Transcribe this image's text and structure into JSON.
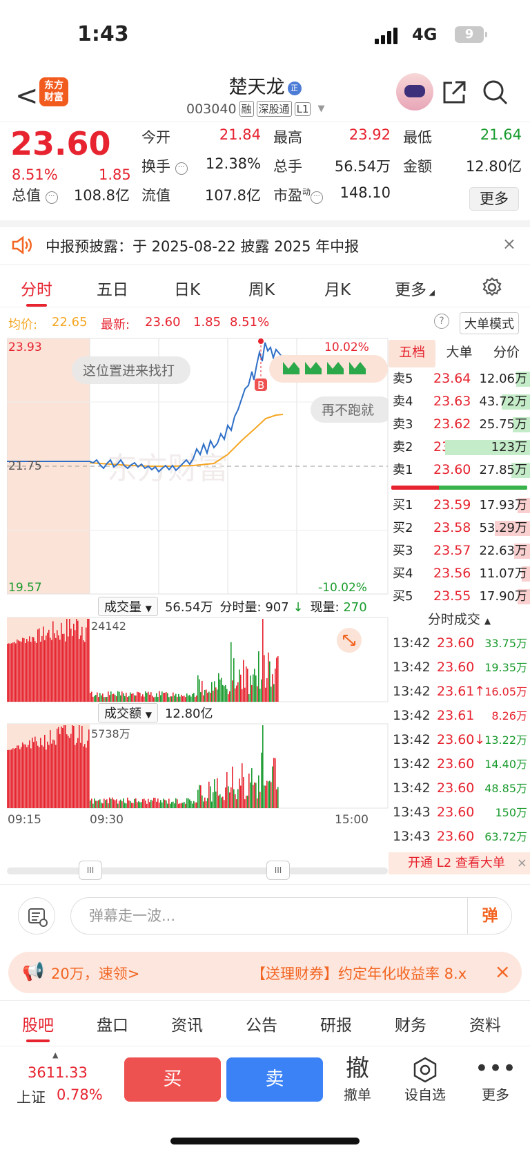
{
  "status": {
    "time": "1:43",
    "network": "4G",
    "battery": "9"
  },
  "header": {
    "back": "<",
    "logo_line1": "东方",
    "logo_line2": "财富",
    "name": "楚天龙",
    "name_badge": "正",
    "code": "003040",
    "tags": [
      "融",
      "深股通",
      "L1"
    ]
  },
  "quote": {
    "price": "23.60",
    "change_pct": "8.51%",
    "change_abs": "1.85",
    "open_label": "今开",
    "open": "21.84",
    "high_label": "最高",
    "high": "23.92",
    "low_label": "最低",
    "low": "21.64",
    "turnover_label": "换手",
    "turnover": "12.38%",
    "volume_label": "总手",
    "volume": "56.54万",
    "amount_label": "金额",
    "amount": "12.80亿",
    "mktcap_label": "总值",
    "mktcap": "108.8亿",
    "float_label": "流值",
    "float": "107.8亿",
    "pe_label": "市盈",
    "pe_sup": "动",
    "pe": "148.10",
    "more": "更多"
  },
  "notice": {
    "text": "中报预披露：于 2025-08-22 披露 2025 年中报",
    "close": "×"
  },
  "chart_tabs": [
    "分时",
    "五日",
    "日K",
    "周K",
    "月K",
    "更多"
  ],
  "avg_line": {
    "avg_label": "均价:",
    "avg": "22.65",
    "last_label": "最新:",
    "last": "23.60",
    "chg": "1.85",
    "pct": "8.51%",
    "mode": "大单模式",
    "help": "?"
  },
  "chart": {
    "y_top": "23.93",
    "y_mid": "21.75",
    "y_bottom": "19.57",
    "pct_top": "10.02%",
    "pct_bottom": "-10.02%",
    "bubble1": "这位置进来找打",
    "bubble2": "再不跑就",
    "b_marker": "B",
    "watermark": "东方财富",
    "vol_label": "成交量",
    "vol_total": "56.54万",
    "vol_extra_label": "分时量:",
    "vol_extra": "907",
    "cur_label": "现量:",
    "cur": "270",
    "vol_max": "24142",
    "amt_label": "成交额",
    "amt_total": "12.80亿",
    "amt_max": "5738万",
    "time_start": "09:15",
    "time_open": "09:30",
    "time_end": "15:00",
    "handle": "III"
  },
  "chart_data": {
    "type": "line",
    "x": [
      "09:15",
      "09:30",
      "15:00"
    ],
    "ylim": [
      19.57,
      23.93
    ],
    "series": []
  },
  "orderbook": {
    "tabs": [
      "五档",
      "大单",
      "分价"
    ],
    "asks": [
      {
        "label": "卖5",
        "price": "23.64",
        "vol": "12.06万",
        "bar": 0.1
      },
      {
        "label": "卖4",
        "price": "23.63",
        "vol": "43.72万",
        "bar": 0.2
      },
      {
        "label": "卖3",
        "price": "23.62",
        "vol": "25.75万",
        "bar": 0.12
      },
      {
        "label": "卖2",
        "price": "23.61",
        "vol": "123万",
        "bar": 0.6
      },
      {
        "label": "卖1",
        "price": "23.60",
        "vol": "27.85万",
        "bar": 0.13
      }
    ],
    "bids": [
      {
        "label": "买1",
        "price": "23.59",
        "vol": "17.93万",
        "bar": 0.09
      },
      {
        "label": "买2",
        "price": "23.58",
        "vol": "53.29万",
        "bar": 0.25
      },
      {
        "label": "买3",
        "price": "23.57",
        "vol": "22.63万",
        "bar": 0.11
      },
      {
        "label": "买4",
        "price": "23.56",
        "vol": "11.07万",
        "bar": 0.06
      },
      {
        "label": "买5",
        "price": "23.55",
        "vol": "17.90万",
        "bar": 0.09
      }
    ],
    "trades_title": "分时成交",
    "trades": [
      {
        "t": "13:42",
        "p": "23.60",
        "v": "33.75万",
        "c": "green"
      },
      {
        "t": "13:42",
        "p": "23.60",
        "v": "19.35万",
        "c": "green"
      },
      {
        "t": "13:42",
        "p": "23.61↑",
        "v": "16.05万",
        "c": "red"
      },
      {
        "t": "13:42",
        "p": "23.61",
        "v": "8.26万",
        "c": "red"
      },
      {
        "t": "13:42",
        "p": "23.60↓",
        "v": "13.22万",
        "c": "green"
      },
      {
        "t": "13:42",
        "p": "23.60",
        "v": "14.40万",
        "c": "green"
      },
      {
        "t": "13:42",
        "p": "23.60",
        "v": "48.85万",
        "c": "green"
      },
      {
        "t": "13:43",
        "p": "23.60",
        "v": "150万",
        "c": "green"
      },
      {
        "t": "13:43",
        "p": "23.60",
        "v": "63.72万",
        "c": "green"
      }
    ],
    "l2": "开通 L2 查看大单"
  },
  "danmu": {
    "placeholder": "弹幕走一波...",
    "btn": "弹"
  },
  "promo": {
    "t1": "20万，速领>",
    "t2": "【送理财券】约定年化收益率 8.x",
    "close": "×"
  },
  "sections": [
    "股吧",
    "盘口",
    "资讯",
    "公告",
    "研报",
    "财务",
    "资料"
  ],
  "bottom": {
    "index_val": "3611.33",
    "index_name": "上证",
    "index_pct": "0.78%",
    "buy": "买",
    "sell": "卖",
    "cancel_glyph": "撤",
    "cancel": "撤单",
    "watch": "设自选",
    "more_glyph": "•••",
    "more": "更多"
  },
  "colors": {
    "up": "#e6232f",
    "down": "#1a9b2e",
    "accent": "#f26522",
    "line": "#2f6fc7",
    "avg": "#f5a623"
  }
}
